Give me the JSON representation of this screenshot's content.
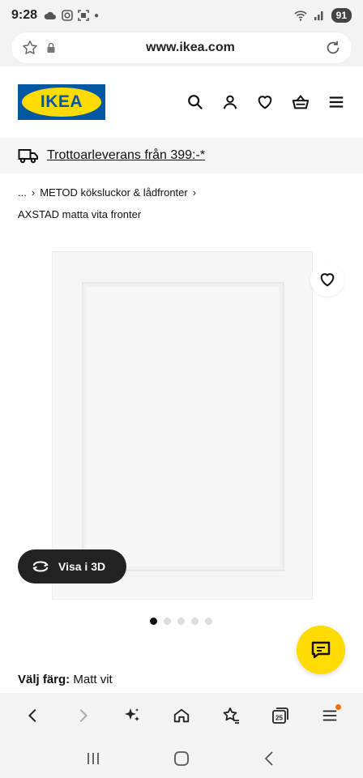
{
  "status": {
    "time": "9:28",
    "battery": "91"
  },
  "browser": {
    "url": "www.ikea.com",
    "tabs_count": "25"
  },
  "header": {
    "logo_text": "IKEA"
  },
  "delivery": {
    "text": "Trottoarleverans från 399:-*"
  },
  "breadcrumb": {
    "ellipsis": "...",
    "sep": "›",
    "category": "METOD köksluckor & lådfronter"
  },
  "product": {
    "subtitle": "AXSTAD matta vita fronter",
    "view3d_label": "Visa i 3D",
    "images_count": 5,
    "active_image": 1
  },
  "color": {
    "label": "Välj färg:",
    "value": "Matt vit"
  },
  "colors": {
    "ikea_blue": "#0058a3",
    "ikea_yellow": "#ffdb00"
  }
}
